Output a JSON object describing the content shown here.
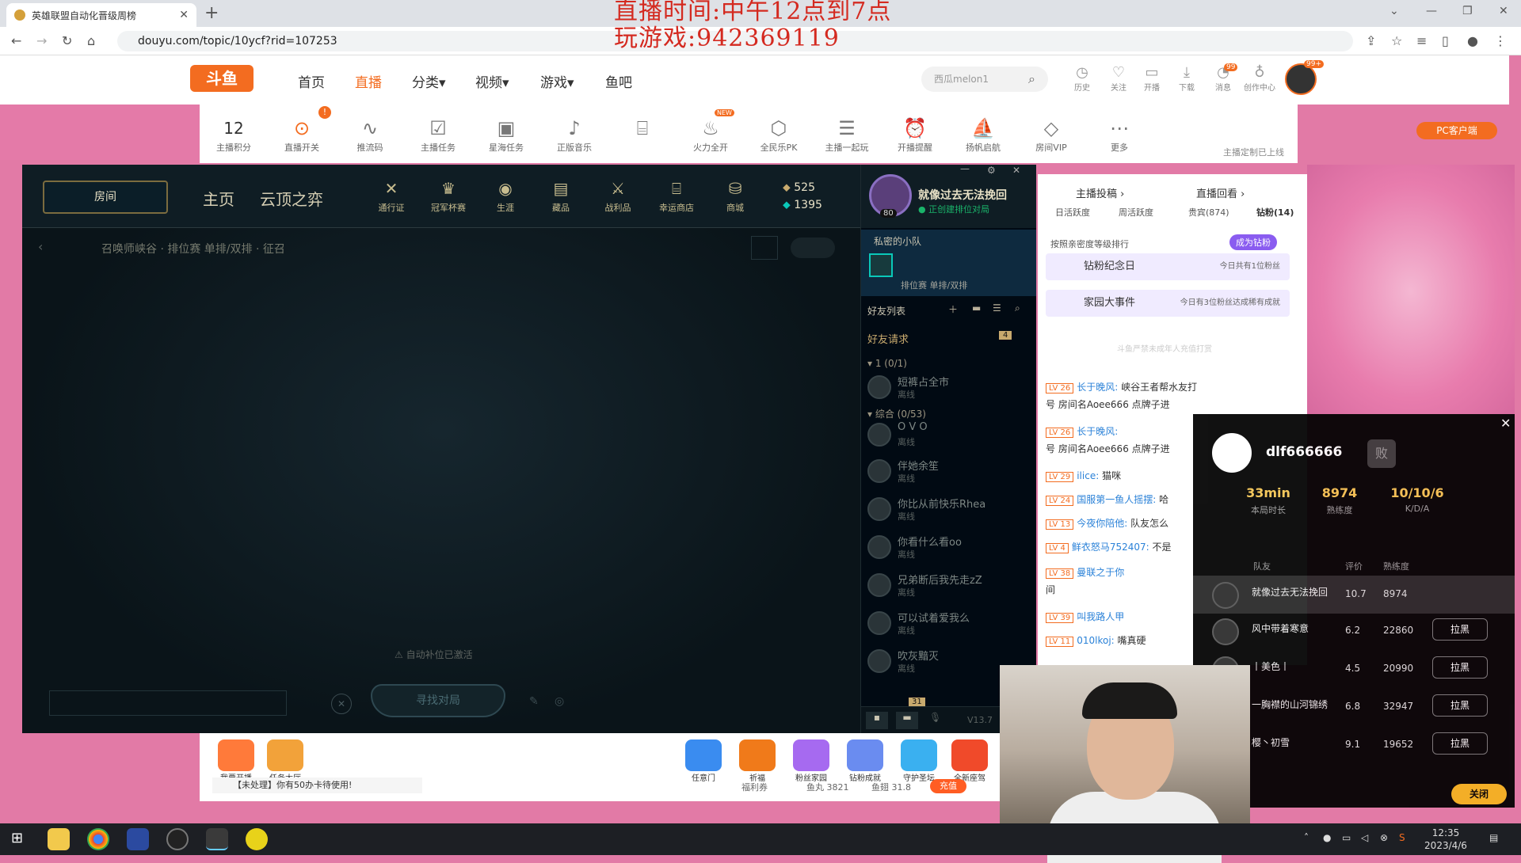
{
  "browser": {
    "tab_title": "英雄联盟自动化晋级周榜",
    "url": "douyu.com/topic/10ycf?rid=107253"
  },
  "overlay": {
    "line1": "直播时间:中午12点到7点",
    "line2": "玩游戏:942369119"
  },
  "douyu": {
    "logo": "斗鱼",
    "nav": [
      "首页",
      "直播",
      "分类▾",
      "视频▾",
      "游戏▾",
      "鱼吧"
    ],
    "search_placeholder": "西瓜melon1",
    "header_icons": [
      "历史",
      "关注",
      "开播",
      "下载",
      "消息",
      "创作中心"
    ],
    "msg_badge": "99",
    "avatar_badge": "99+",
    "toolbar": {
      "score": "12",
      "score_label": "主播积分",
      "items": [
        "直播开关",
        "推流码",
        "主播任务",
        "星海任务",
        "正版音乐",
        "",
        "火力全开",
        "全民乐PK",
        "主播一起玩",
        "开播提醒",
        "扬帆启航",
        "房间VIP",
        "更多"
      ],
      "new_tag": "NEW",
      "alert": "!",
      "pc_button": "PC客户端",
      "pc_sub": "主播定制已上线"
    }
  },
  "lol": {
    "play_label": "房间",
    "nav": [
      "主页",
      "云顶之弈"
    ],
    "icons": [
      "通行证",
      "冠军杯赛",
      "生涯",
      "藏品",
      "战利品",
      "幸运商店",
      "商城"
    ],
    "currency": {
      "be": "525",
      "rp": "1395"
    },
    "game_mode": "召唤师峡谷 · 排位赛 单排/双排 · 征召",
    "autofill": "自动补位已激活",
    "find_match": "寻找对局",
    "version": "V13.7",
    "chat_count": "31",
    "profile": {
      "name": "就像过去无法挽回",
      "status": "正创建排位对局",
      "level": "80"
    },
    "party": {
      "title": "私密的小队",
      "mode": "排位赛 单排/双排"
    },
    "friends_title": "好友列表",
    "friend_requests": "好友请求",
    "friend_requests_count": "4",
    "group1": "1 (0/1)",
    "group2": "综合 (0/53)",
    "friends": [
      {
        "name": "短裤占全市",
        "status": "离线"
      },
      {
        "name": "O V O",
        "status": "离线"
      },
      {
        "name": "伴她余笙",
        "status": "离线"
      },
      {
        "name": "你比从前快乐Rhea",
        "status": "离线"
      },
      {
        "name": "你看什么看oo",
        "status": "离线"
      },
      {
        "name": "兄弟断后我先走zZ",
        "status": "离线"
      },
      {
        "name": "可以试着爱我么",
        "status": "离线"
      },
      {
        "name": "吹灰黯灭",
        "status": "离线"
      }
    ]
  },
  "sidebar": {
    "top_links": [
      "主播投稿 ›",
      "直播回看 ›"
    ],
    "tabs": [
      "日活跃度",
      "周活跃度",
      "贵宾(874)",
      "钻粉(14)"
    ],
    "sort_label": "按照亲密度等级排行",
    "become_fan": "成为钻粉",
    "banner1": "钻粉纪念日",
    "banner1_sub": "今日共有1位粉丝",
    "banner2": "家园大事件",
    "banner2_sub": "今日有3位粉丝达成稀有成就",
    "warning": "斗鱼严禁未成年人充值打赏",
    "messages": [
      {
        "lv": "LV 26",
        "user": "长于晚风:",
        "text": "峡谷王者帮水友打"
      },
      {
        "lv": "",
        "user": "",
        "text": "号 房间名Aoee666 点牌子进"
      },
      {
        "lv": "LV 26",
        "user": "长于晚风:",
        "text": ""
      },
      {
        "lv": "",
        "user": "",
        "text": "号 房间名Aoee666 点牌子进"
      },
      {
        "lv": "LV 29",
        "user": "ilice:",
        "text": "猫咪"
      },
      {
        "lv": "LV 24",
        "user": "国服第一鱼人摇摆:",
        "text": "哈"
      },
      {
        "lv": "LV 13",
        "user": "今夜你陪他:",
        "text": "队友怎么"
      },
      {
        "lv": "LV 4",
        "user": "鲜衣怒马752407:",
        "text": "不是"
      },
      {
        "lv": "LV 38",
        "user": "曼联之于你",
        "text": ""
      },
      {
        "lv": "",
        "user": "",
        "text": "间"
      },
      {
        "lv": "LV 39",
        "user": "叫我路人甲",
        "text": ""
      },
      {
        "lv": "LV 11",
        "user": "010lkoj:",
        "text": "嘴真硬"
      }
    ]
  },
  "stats_popup": {
    "name": "dlf666666",
    "result": "败",
    "stats": [
      {
        "value": "33min",
        "label": "本局时长"
      },
      {
        "value": "8974",
        "label": "熟练度"
      },
      {
        "value": "10/10/6",
        "label": "K/D/A"
      }
    ],
    "headers": [
      "队友",
      "评价",
      "熟练度"
    ],
    "rows": [
      {
        "name": "就像过去无法挽回",
        "score": "10.7",
        "skill": "8974",
        "button": ""
      },
      {
        "name": "风中带着寒意",
        "score": "6.2",
        "skill": "22860",
        "button": "拉黑"
      },
      {
        "name": "丨美色丨",
        "score": "4.5",
        "skill": "20990",
        "button": "拉黑"
      },
      {
        "name": "一胸襟的山河锦绣",
        "score": "6.8",
        "skill": "32947",
        "button": "拉黑"
      },
      {
        "name": "樱丶初雪",
        "score": "9.1",
        "skill": "19652",
        "button": "拉黑"
      }
    ],
    "close": "关闭"
  },
  "bottom": {
    "start_live": "我要开播",
    "task_hall": "任务大厅",
    "gifts": [
      "任意门",
      "祈福",
      "粉丝家园",
      "钻粉成就",
      "守护圣坛",
      "全新座驾"
    ],
    "notice": "【未处理】你有50办卡待使用!",
    "welfare": "福利券",
    "fishball": "鱼丸 3821",
    "fishpole": "鱼翅 31.8",
    "recharge": "充值"
  },
  "taskbar": {
    "time": "12:35",
    "date": "2023/4/6"
  }
}
